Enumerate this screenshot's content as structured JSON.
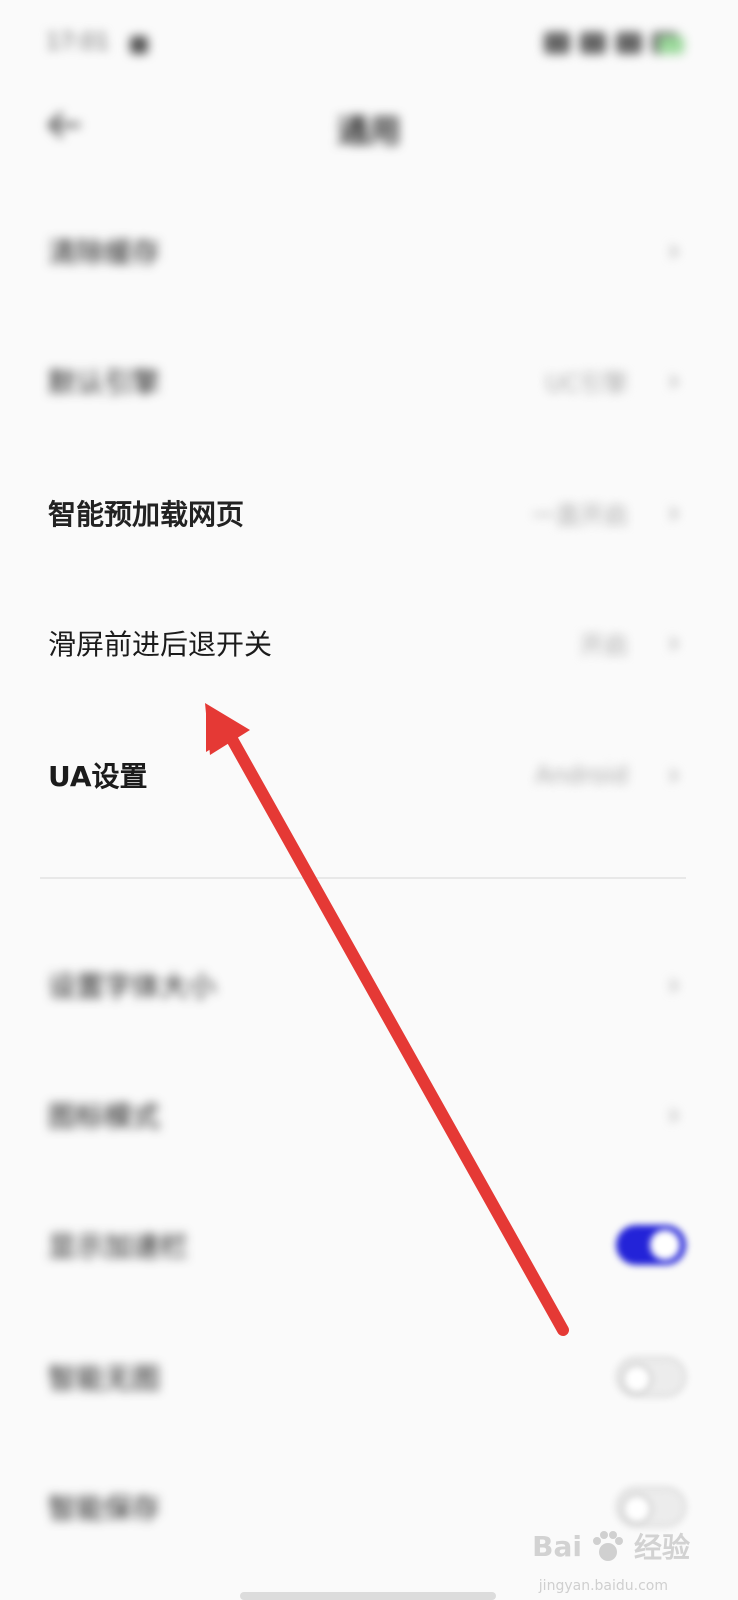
{
  "status_bar": {
    "time": "17:01"
  },
  "header": {
    "title": "通用"
  },
  "rows_top": [
    {
      "label": "清除缓存",
      "value": "",
      "clear": false
    },
    {
      "label": "默认引擎",
      "value": "UC引擎",
      "clear": false
    },
    {
      "label": "智能预加载网页",
      "value": "一直开启",
      "clear": true
    },
    {
      "label": "滑屏前进后退开关",
      "value": "开启",
      "clear": true
    },
    {
      "label": "UA设置",
      "value": "Android",
      "clear": true
    }
  ],
  "rows_bottom": [
    {
      "label": "设置字体大小",
      "type": "chevron"
    },
    {
      "label": "图标模式",
      "type": "chevron"
    },
    {
      "label": "显示加速栏",
      "type": "toggle",
      "on": true
    },
    {
      "label": "智能无图",
      "type": "toggle",
      "on": false
    },
    {
      "label": "智能保存",
      "type": "toggle",
      "on": false
    }
  ],
  "watermark": {
    "brand": "Bai",
    "suffix": "经验",
    "url": "jingyan.baidu.com"
  },
  "colors": {
    "accent": "#2323d8",
    "annotation": "#e53935"
  }
}
